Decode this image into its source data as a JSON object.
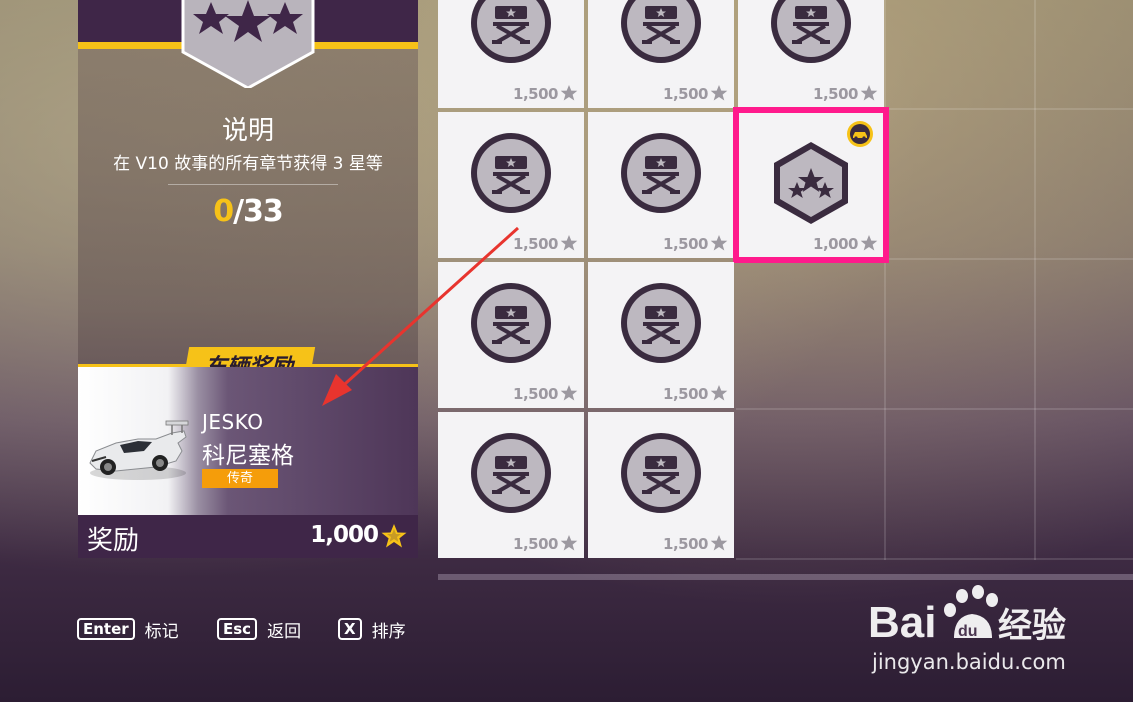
{
  "left_panel": {
    "description_title": "说明",
    "description_text": "在 V10 故事的所有章节获得 3 星等",
    "progress_current": "0",
    "progress_total": "/33",
    "reward_tag": "车辆奖励",
    "car_model": "JESKO",
    "car_brand": "科尼塞格",
    "car_rarity": "传奇",
    "reward_label": "奖励",
    "reward_amount": "1,000"
  },
  "tiles": [
    {
      "cost": "1,500"
    },
    {
      "cost": "1,500"
    },
    {
      "cost": "1,500"
    },
    {
      "cost": "1,500"
    },
    {
      "cost": "1,500"
    },
    {
      "cost": "1,000"
    },
    {
      "cost": "1,500"
    },
    {
      "cost": "1,500"
    },
    {
      "cost": "1,500"
    },
    {
      "cost": "1,500"
    }
  ],
  "footer": {
    "enter_key": "Enter",
    "enter_label": "标记",
    "esc_key": "Esc",
    "esc_label": "返回",
    "x_key": "X",
    "x_label": "排序"
  },
  "watermark": {
    "brand": "Bai 经验",
    "url": "jingyan.baidu.com"
  },
  "colors": {
    "accent_yellow": "#f6c218",
    "panel_purple": "#3f2648",
    "selection_pink": "#ff1a8c",
    "rarity_orange": "#f59d0a"
  }
}
